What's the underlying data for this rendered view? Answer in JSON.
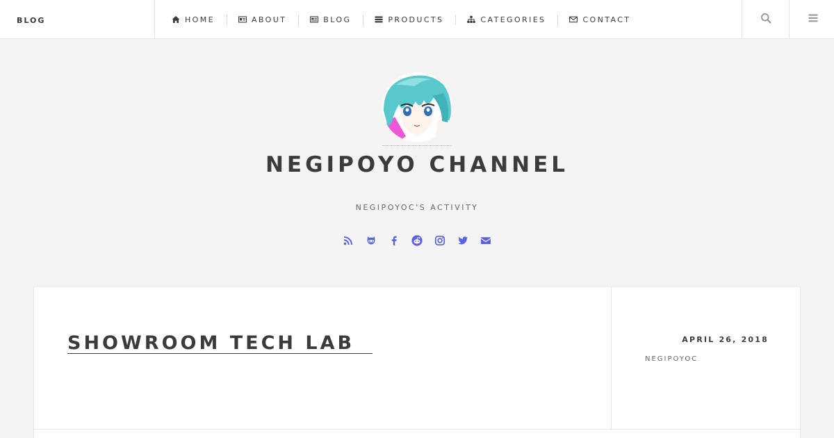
{
  "header": {
    "brand": "BLOG",
    "nav": [
      {
        "label": "HOME",
        "icon": "home-icon"
      },
      {
        "label": "ABOUT",
        "icon": "id-card-icon"
      },
      {
        "label": "BLOG",
        "icon": "newspaper-icon"
      },
      {
        "label": "PRODUCTS",
        "icon": "list-icon"
      },
      {
        "label": "CATEGORIES",
        "icon": "sitemap-icon"
      },
      {
        "label": "CONTACT",
        "icon": "envelope-icon"
      }
    ],
    "tools": [
      {
        "icon": "search-icon"
      },
      {
        "icon": "menu-icon"
      }
    ]
  },
  "intro": {
    "avatar": "anime-girl-avatar",
    "title": "NEGIPOYO CHANNEL",
    "subtitle": "NEGIPOYOC'S ACTIVITY",
    "social": [
      "rss-icon",
      "github-alt-icon",
      "facebook-icon",
      "reddit-icon",
      "instagram-icon",
      "twitter-icon",
      "envelope-icon"
    ]
  },
  "post": {
    "title": "SHOWROOM TECH LAB",
    "date": "APRIL 26, 2018",
    "author": "NEGIPOYOC"
  },
  "colors": {
    "background": "#f4f4f4",
    "text": "#3c3b3b",
    "muted": "#646464",
    "accent": "#5a62e0",
    "border": "#e6e6e6"
  }
}
